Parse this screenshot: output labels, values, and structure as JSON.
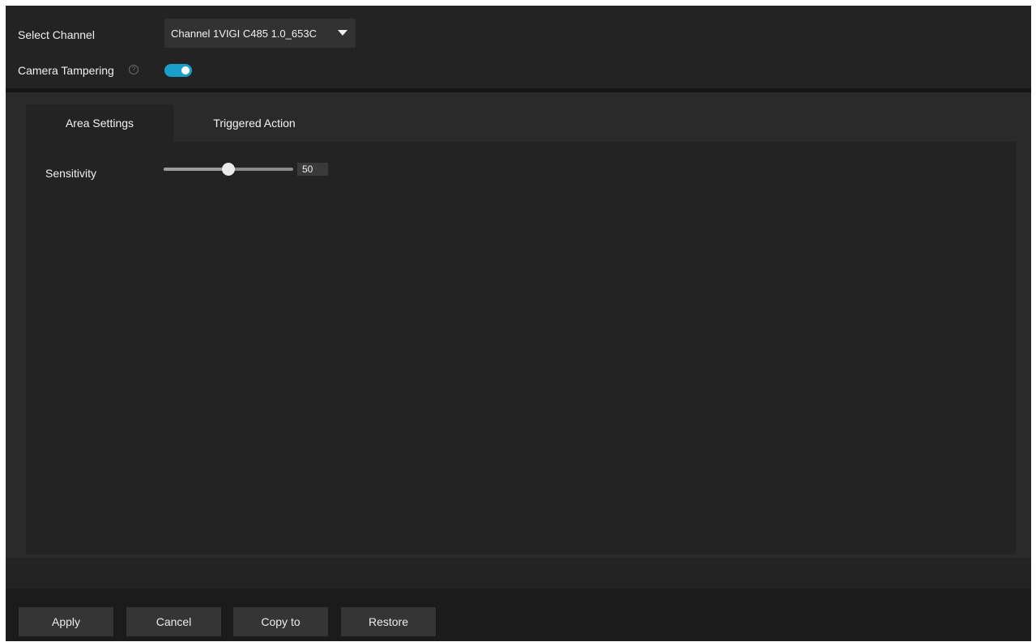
{
  "top": {
    "select_channel_label": "Select Channel",
    "channel_value": "Channel 1VIGI C485 1.0_653C",
    "camera_tampering_label": "Camera Tampering",
    "camera_tampering_enabled": true,
    "help_glyph": "?"
  },
  "tabs": [
    {
      "label": "Area Settings",
      "active": true
    },
    {
      "label": "Triggered Action",
      "active": false
    }
  ],
  "area_settings": {
    "sensitivity_label": "Sensitivity",
    "sensitivity_value": "50",
    "sensitivity_min": 0,
    "sensitivity_max": 100
  },
  "buttons": {
    "apply": "Apply",
    "cancel": "Cancel",
    "copy_to": "Copy to",
    "restore": "Restore"
  },
  "colors": {
    "accent": "#1aa0c8",
    "background": "#232323",
    "panel": "#2a2a2a"
  },
  "icons": {
    "help": "help-circle-icon",
    "dropdown": "caret-down-icon"
  }
}
